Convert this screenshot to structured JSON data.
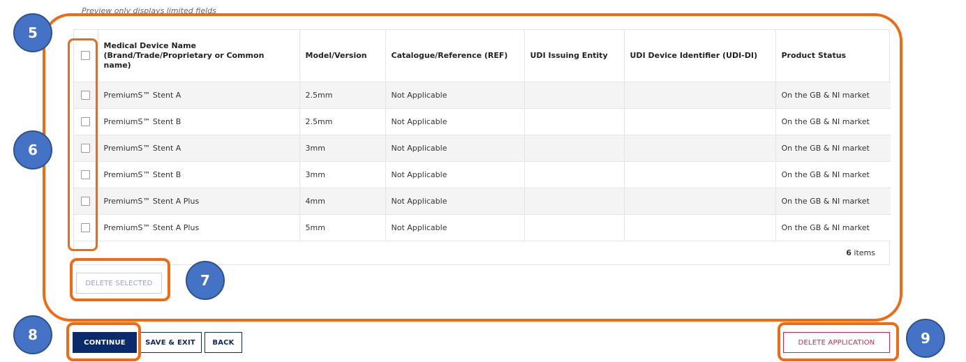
{
  "preview_note": "Preview only displays limited fields",
  "table": {
    "headers": [
      "",
      "Medical Device Name (Brand/Trade/Proprietary or Common name)",
      "Model/Version",
      "Catalogue/Reference (REF)",
      "UDI Issuing Entity",
      "UDI Device Identifier (UDI-DI)",
      "Product Status"
    ],
    "rows": [
      {
        "name": "PremiumS™ Stent A",
        "model": "2.5mm",
        "ref": "Not Applicable",
        "issuer": "",
        "udi_di": "",
        "status": "On the GB & NI market"
      },
      {
        "name": "PremiumS™ Stent B",
        "model": "2.5mm",
        "ref": "Not Applicable",
        "issuer": "",
        "udi_di": "",
        "status": "On the GB & NI market"
      },
      {
        "name": "PremiumS™ Stent A",
        "model": "3mm",
        "ref": "Not Applicable",
        "issuer": "",
        "udi_di": "",
        "status": "On the GB & NI market"
      },
      {
        "name": "PremiumS™ Stent B",
        "model": "3mm",
        "ref": "Not Applicable",
        "issuer": "",
        "udi_di": "",
        "status": "On the GB & NI market"
      },
      {
        "name": "PremiumS™ Stent A Plus",
        "model": "4mm",
        "ref": "Not Applicable",
        "issuer": "",
        "udi_di": "",
        "status": "On the GB & NI market"
      },
      {
        "name": "PremiumS™ Stent A Plus",
        "model": "5mm",
        "ref": "Not Applicable",
        "issuer": "",
        "udi_di": "",
        "status": "On the GB & NI market"
      }
    ],
    "item_count": "6",
    "items_label": "items"
  },
  "buttons": {
    "delete_selected": "DELETE SELECTED",
    "continue": "CONTINUE",
    "save_exit": "SAVE & EXIT",
    "back": "BACK",
    "delete_application": "DELETE APPLICATION"
  },
  "annotations": {
    "badge_5": "5",
    "badge_6": "6",
    "badge_7": "7",
    "badge_8": "8",
    "badge_9": "9"
  },
  "colors": {
    "annotation_outline": "#f06a12",
    "badge_fill": "#4472c4",
    "primary_button": "#0b2a6b",
    "danger": "#d4234a"
  }
}
